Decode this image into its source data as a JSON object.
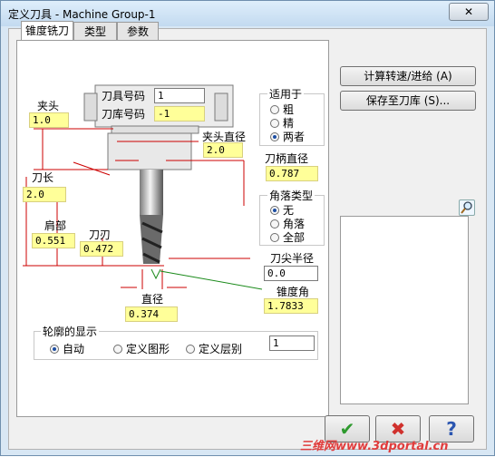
{
  "window": {
    "title": "定义刀具 - Machine Group-1",
    "close_glyph": "✕"
  },
  "tabs": [
    "锥度铣刀",
    "类型",
    "参数"
  ],
  "holder": {
    "tool_number_label": "刀具号码",
    "tool_number_value": "1",
    "lib_number_label": "刀库号码",
    "lib_number_value": "-1",
    "chuck_label": "夹头",
    "chuck_value": "1.0",
    "chuck_diameter_label": "夹头直径",
    "chuck_diameter_value": "2.0",
    "shank_diameter_label": "刀柄直径",
    "shank_diameter_value": "0.787",
    "tool_length_label": "刀长",
    "tool_length_value": "2.0",
    "shoulder_label": "肩部",
    "shoulder_value": "0.551",
    "flute_label": "刀刃",
    "flute_value": "0.472",
    "diameter_label": "直径",
    "diameter_value": "0.374",
    "tip_radius_label": "刀尖半径",
    "tip_radius_value": "0.0",
    "taper_label": "锥度角",
    "taper_value": "1.7833"
  },
  "applies_to": {
    "title": "适用于",
    "options": [
      "粗",
      "精",
      "两者"
    ],
    "selected": 2
  },
  "corner_type": {
    "title": "角落类型",
    "options": [
      "无",
      "角落",
      "全部"
    ],
    "selected": 0
  },
  "profile": {
    "title": "轮廓的显示",
    "options": [
      "自动",
      "定义图形",
      "定义层别"
    ],
    "selected": 0,
    "value": "1"
  },
  "buttons": {
    "calc": "计算转速/进给 (A)",
    "save": "保存至刀库 (S)..."
  },
  "dialog_buttons": {
    "ok": "✔",
    "cancel": "✖",
    "help": "?"
  },
  "watermark": "三维网www.3dportal.cn",
  "colors": {
    "ok": "#2e9a2e",
    "cancel": "#d0312d",
    "help": "#2a55b0",
    "dim_line": "#cc0000",
    "dim_green": "#1a8a1a"
  }
}
